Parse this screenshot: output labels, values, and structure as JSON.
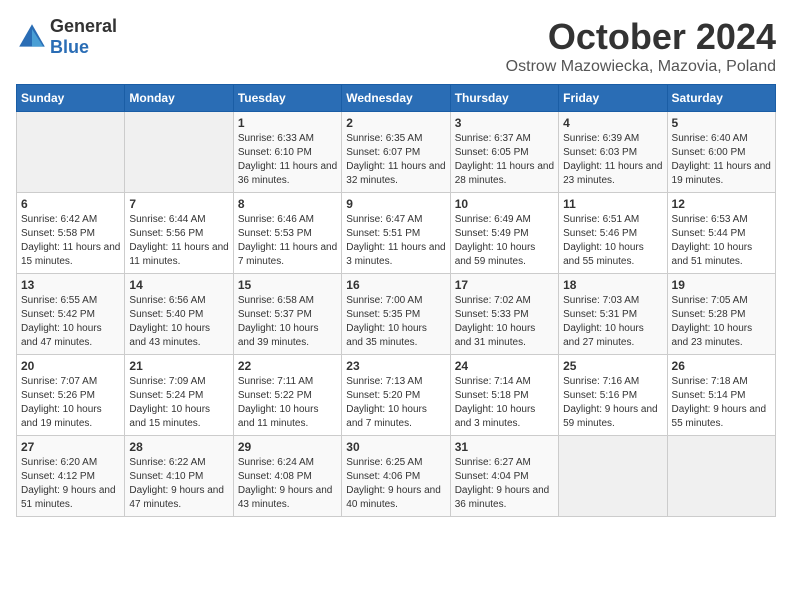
{
  "logo": {
    "general": "General",
    "blue": "Blue"
  },
  "title": "October 2024",
  "location": "Ostrow Mazowiecka, Mazovia, Poland",
  "days_header": [
    "Sunday",
    "Monday",
    "Tuesday",
    "Wednesday",
    "Thursday",
    "Friday",
    "Saturday"
  ],
  "weeks": [
    [
      {
        "day": "",
        "info": ""
      },
      {
        "day": "",
        "info": ""
      },
      {
        "day": "1",
        "info": "Sunrise: 6:33 AM\nSunset: 6:10 PM\nDaylight: 11 hours and 36 minutes."
      },
      {
        "day": "2",
        "info": "Sunrise: 6:35 AM\nSunset: 6:07 PM\nDaylight: 11 hours and 32 minutes."
      },
      {
        "day": "3",
        "info": "Sunrise: 6:37 AM\nSunset: 6:05 PM\nDaylight: 11 hours and 28 minutes."
      },
      {
        "day": "4",
        "info": "Sunrise: 6:39 AM\nSunset: 6:03 PM\nDaylight: 11 hours and 23 minutes."
      },
      {
        "day": "5",
        "info": "Sunrise: 6:40 AM\nSunset: 6:00 PM\nDaylight: 11 hours and 19 minutes."
      }
    ],
    [
      {
        "day": "6",
        "info": "Sunrise: 6:42 AM\nSunset: 5:58 PM\nDaylight: 11 hours and 15 minutes."
      },
      {
        "day": "7",
        "info": "Sunrise: 6:44 AM\nSunset: 5:56 PM\nDaylight: 11 hours and 11 minutes."
      },
      {
        "day": "8",
        "info": "Sunrise: 6:46 AM\nSunset: 5:53 PM\nDaylight: 11 hours and 7 minutes."
      },
      {
        "day": "9",
        "info": "Sunrise: 6:47 AM\nSunset: 5:51 PM\nDaylight: 11 hours and 3 minutes."
      },
      {
        "day": "10",
        "info": "Sunrise: 6:49 AM\nSunset: 5:49 PM\nDaylight: 10 hours and 59 minutes."
      },
      {
        "day": "11",
        "info": "Sunrise: 6:51 AM\nSunset: 5:46 PM\nDaylight: 10 hours and 55 minutes."
      },
      {
        "day": "12",
        "info": "Sunrise: 6:53 AM\nSunset: 5:44 PM\nDaylight: 10 hours and 51 minutes."
      }
    ],
    [
      {
        "day": "13",
        "info": "Sunrise: 6:55 AM\nSunset: 5:42 PM\nDaylight: 10 hours and 47 minutes."
      },
      {
        "day": "14",
        "info": "Sunrise: 6:56 AM\nSunset: 5:40 PM\nDaylight: 10 hours and 43 minutes."
      },
      {
        "day": "15",
        "info": "Sunrise: 6:58 AM\nSunset: 5:37 PM\nDaylight: 10 hours and 39 minutes."
      },
      {
        "day": "16",
        "info": "Sunrise: 7:00 AM\nSunset: 5:35 PM\nDaylight: 10 hours and 35 minutes."
      },
      {
        "day": "17",
        "info": "Sunrise: 7:02 AM\nSunset: 5:33 PM\nDaylight: 10 hours and 31 minutes."
      },
      {
        "day": "18",
        "info": "Sunrise: 7:03 AM\nSunset: 5:31 PM\nDaylight: 10 hours and 27 minutes."
      },
      {
        "day": "19",
        "info": "Sunrise: 7:05 AM\nSunset: 5:28 PM\nDaylight: 10 hours and 23 minutes."
      }
    ],
    [
      {
        "day": "20",
        "info": "Sunrise: 7:07 AM\nSunset: 5:26 PM\nDaylight: 10 hours and 19 minutes."
      },
      {
        "day": "21",
        "info": "Sunrise: 7:09 AM\nSunset: 5:24 PM\nDaylight: 10 hours and 15 minutes."
      },
      {
        "day": "22",
        "info": "Sunrise: 7:11 AM\nSunset: 5:22 PM\nDaylight: 10 hours and 11 minutes."
      },
      {
        "day": "23",
        "info": "Sunrise: 7:13 AM\nSunset: 5:20 PM\nDaylight: 10 hours and 7 minutes."
      },
      {
        "day": "24",
        "info": "Sunrise: 7:14 AM\nSunset: 5:18 PM\nDaylight: 10 hours and 3 minutes."
      },
      {
        "day": "25",
        "info": "Sunrise: 7:16 AM\nSunset: 5:16 PM\nDaylight: 9 hours and 59 minutes."
      },
      {
        "day": "26",
        "info": "Sunrise: 7:18 AM\nSunset: 5:14 PM\nDaylight: 9 hours and 55 minutes."
      }
    ],
    [
      {
        "day": "27",
        "info": "Sunrise: 6:20 AM\nSunset: 4:12 PM\nDaylight: 9 hours and 51 minutes."
      },
      {
        "day": "28",
        "info": "Sunrise: 6:22 AM\nSunset: 4:10 PM\nDaylight: 9 hours and 47 minutes."
      },
      {
        "day": "29",
        "info": "Sunrise: 6:24 AM\nSunset: 4:08 PM\nDaylight: 9 hours and 43 minutes."
      },
      {
        "day": "30",
        "info": "Sunrise: 6:25 AM\nSunset: 4:06 PM\nDaylight: 9 hours and 40 minutes."
      },
      {
        "day": "31",
        "info": "Sunrise: 6:27 AM\nSunset: 4:04 PM\nDaylight: 9 hours and 36 minutes."
      },
      {
        "day": "",
        "info": ""
      },
      {
        "day": "",
        "info": ""
      }
    ]
  ]
}
